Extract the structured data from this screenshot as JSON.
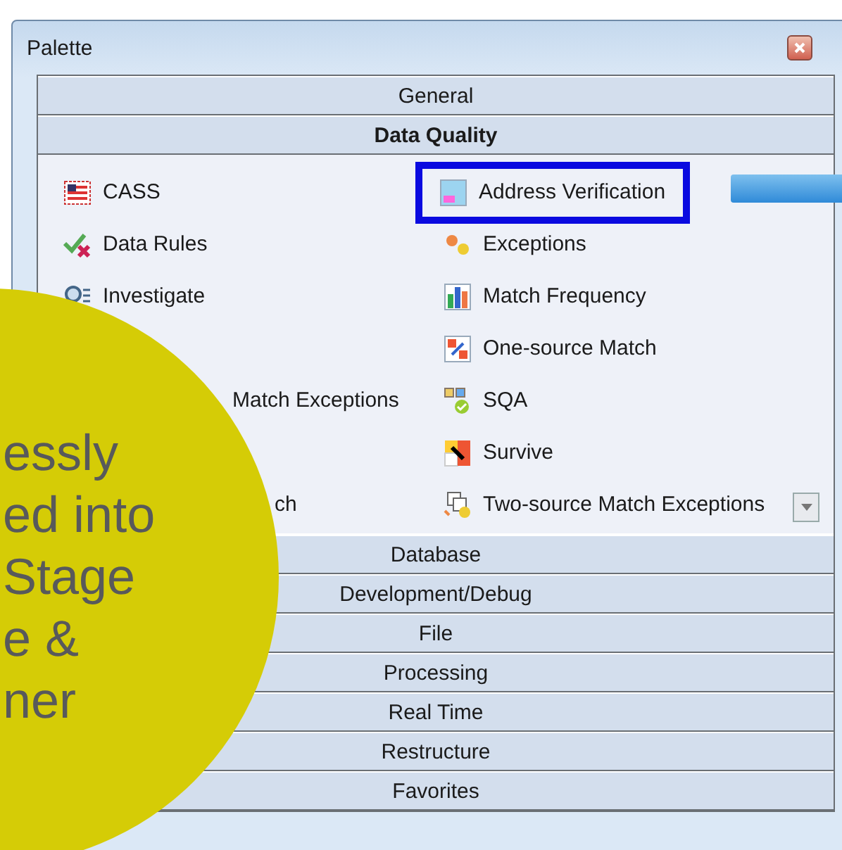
{
  "window": {
    "title": "Palette"
  },
  "categories_top": [
    {
      "label": "General",
      "selected": false
    },
    {
      "label": "Data Quality",
      "selected": true
    }
  ],
  "rows": [
    {
      "left": {
        "label": "CASS"
      },
      "right": {
        "label": "Address Verification",
        "highlighted": true
      }
    },
    {
      "left": {
        "label": "Data Rules"
      },
      "right": {
        "label": "Exceptions",
        "highlighted": false
      }
    },
    {
      "left": {
        "label": "Investigate"
      },
      "right": {
        "label": "Match Frequency",
        "highlighted": false
      }
    },
    {
      "right": {
        "label": "One-source Match",
        "highlighted": false
      }
    },
    {
      "left": {
        "label": "Match Exceptions"
      },
      "right": {
        "label": "SQA",
        "highlighted": false
      }
    },
    {
      "right": {
        "label": "Survive",
        "highlighted": false
      }
    },
    {
      "left": {
        "label": "ch"
      },
      "right": {
        "label": "Two-source Match Exceptions",
        "highlighted": false
      }
    }
  ],
  "categories_bottom": [
    {
      "label": "Database",
      "selected": false
    },
    {
      "label": "Development/Debug",
      "selected": false
    },
    {
      "label": "File",
      "selected": false
    },
    {
      "label": "Processing",
      "selected": false
    },
    {
      "label": "Real Time",
      "selected": false
    },
    {
      "label": "Restructure",
      "selected": false
    },
    {
      "label": "Favorites",
      "selected": false
    }
  ],
  "callout": {
    "lines": [
      "essly",
      "ed into",
      "Stage",
      "e &",
      "ner"
    ]
  }
}
